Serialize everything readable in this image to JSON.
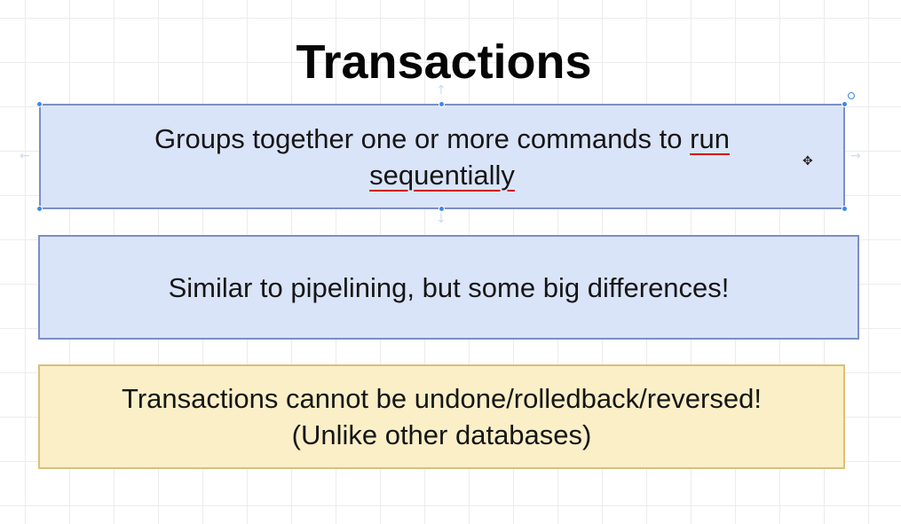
{
  "slide": {
    "title": "Transactions",
    "boxes": [
      {
        "lines": [
          {
            "plain": "Groups together one or more commands to ",
            "squiggle": "run"
          },
          {
            "plain": "",
            "squiggle": "sequentially"
          }
        ],
        "fill": "#dae4f9",
        "border": "#7c8fc6",
        "selected": true
      },
      {
        "lines": [
          "Similar to pipelining, but some big differences!"
        ],
        "fill": "#dae4f9",
        "border": "#7c8fc6"
      },
      {
        "lines": [
          "Transactions cannot be undone/rolledback/reversed!",
          "(Unlike other databases)"
        ],
        "fill": "#fbefc7",
        "border": "#d9c07a"
      }
    ]
  },
  "colors": {
    "spellcheck_underline": "#d0021b",
    "selection_handle": "#3d8ae0"
  },
  "icons": {
    "cursor": "crosshair-move-cursor-icon",
    "rotate": "rotate-handle-icon"
  }
}
